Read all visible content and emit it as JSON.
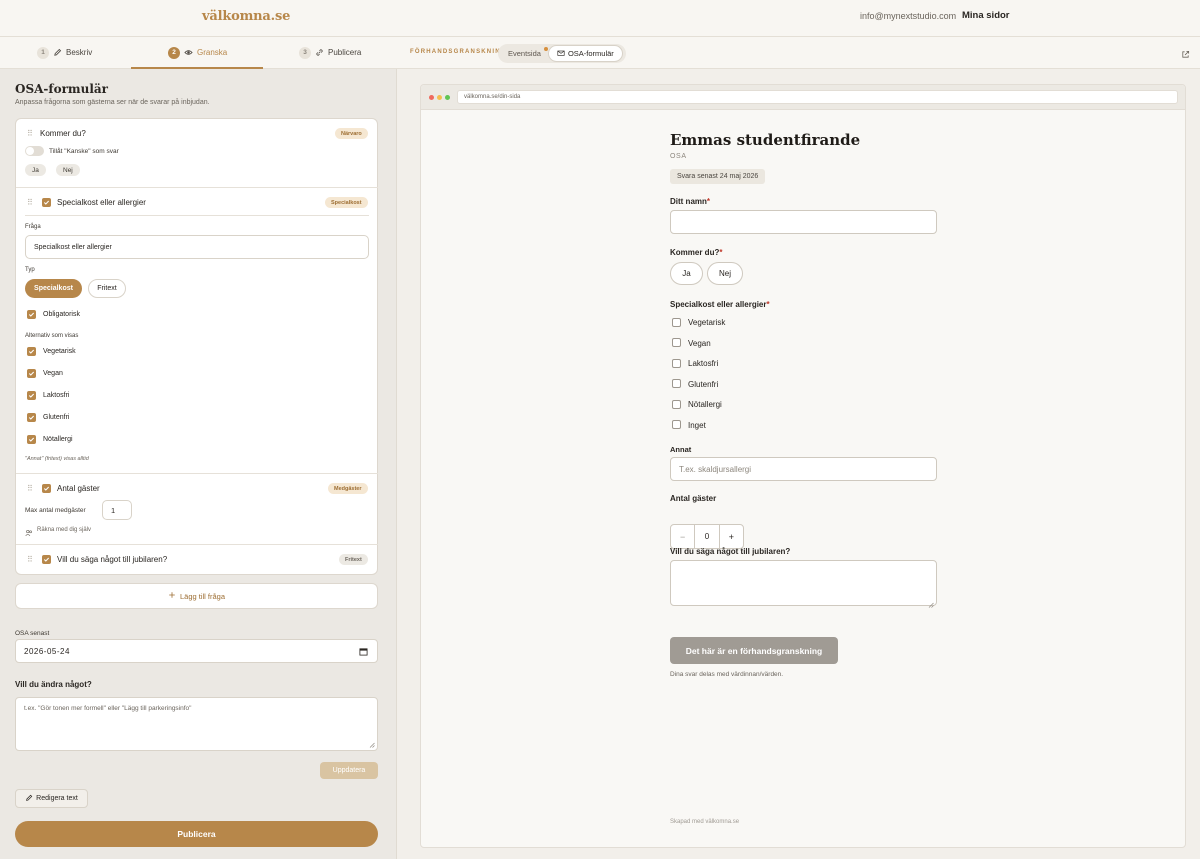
{
  "header": {
    "logo": "välkomna.se",
    "email": "info@mynextstudio.com",
    "my_pages": "Mina sidor"
  },
  "steps": [
    {
      "num": "1",
      "label": "Beskriv",
      "icon": "pencil-icon"
    },
    {
      "num": "2",
      "label": "Granska",
      "icon": "eye-icon",
      "active": true
    },
    {
      "num": "3",
      "label": "Publicera",
      "icon": "link-icon"
    }
  ],
  "preview_bar": {
    "label": "FÖRHANDSGRANSKNING",
    "tabs": [
      "Eventsida",
      "OSA-formulär"
    ],
    "active_tab": "OSA-formulär"
  },
  "editor": {
    "title": "OSA-formulär",
    "subtitle": "Anpassa frågorna som gästerna ser när de svarar på inbjudan.",
    "questions": {
      "attendance": {
        "label": "Kommer du?",
        "badge": "Närvaro",
        "toggle_label": "Tillåt \"Kanske\" som svar",
        "options": [
          "Ja",
          "Nej"
        ]
      },
      "diet": {
        "label": "Specialkost eller allergier",
        "badge": "Specialkost",
        "question_label": "Fråga",
        "question_value": "Specialkost eller allergier",
        "type_label": "Typ",
        "type_options": [
          "Specialkost",
          "Fritext"
        ],
        "required_label": "Obligatorisk",
        "alternatives_label": "Alternativ som visas",
        "alternatives": [
          "Vegetarisk",
          "Vegan",
          "Laktosfri",
          "Glutenfri",
          "Nötallergi"
        ],
        "note": "\"Annat\" (fritext) visas alltid"
      },
      "guests": {
        "label": "Antal gäster",
        "badge": "Medgäster",
        "max_label": "Max antal medgäster",
        "max_value": "1",
        "count_self": "Räkna med dig själv"
      },
      "message": {
        "label": "Vill du säga något till jubilaren?",
        "badge": "Fritext"
      }
    },
    "add_question": "Lägg till fråga",
    "osa_deadline_label": "OSA senast",
    "osa_deadline_value": "2026-05-24",
    "change_title": "Vill du ändra något?",
    "change_placeholder": "t.ex. \"Gör tonen mer formell\" eller \"Lägg till parkeringsinfo\"",
    "update_button": "Uppdatera",
    "edit_text_button": "Redigera text",
    "publish_button": "Publicera"
  },
  "preview": {
    "url": "välkomna.se/din-sida",
    "event_title": "Emmas studentfirande",
    "osa": "OSA",
    "deadline": "Svara senast 24 maj 2026",
    "name_label": "Ditt namn",
    "attend_label": "Kommer du?",
    "attend_options": [
      "Ja",
      "Nej"
    ],
    "diet_label": "Specialkost eller allergier",
    "diet_options": [
      "Vegetarisk",
      "Vegan",
      "Laktosfri",
      "Glutenfri",
      "Nötallergi",
      "Inget"
    ],
    "other_label": "Annat",
    "other_placeholder": "T.ex. skaldjursallergi",
    "guests_label": "Antal gäster",
    "guests_value": "0",
    "message_label": "Vill du säga något till jubilaren?",
    "preview_button": "Det här är en förhandsgranskning",
    "shared_note": "Dina svar delas med värdinnan/värden.",
    "footer": "Skapad med välkomna.se"
  },
  "colors": {
    "accent": "#b7874a",
    "badge_bg": "#f5e7d2",
    "required": "#c0392b"
  }
}
